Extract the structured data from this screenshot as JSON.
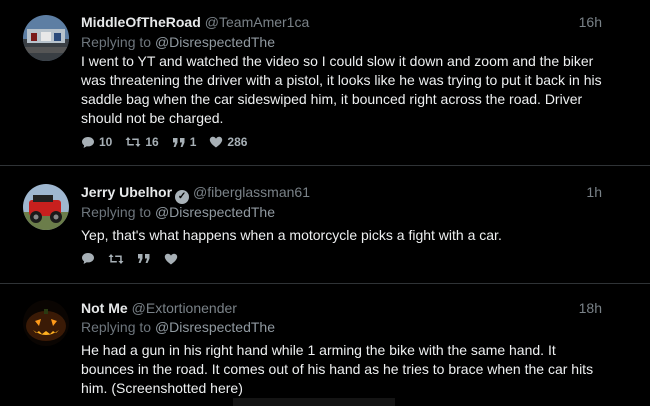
{
  "tweets": [
    {
      "name": "MiddleOfTheRoad",
      "handle": "@TeamAmer1ca",
      "time": "16h",
      "reply_prefix": "Replying to ",
      "reply_to": "@DisrespectedThe",
      "text": "I went to YT and watched the video so I could slow it down and zoom and the biker was threatening the driver with a pistol, it looks like he was trying to put it back in his saddle bag when the car sideswiped him, it bounced right across the road. Driver should not be charged.",
      "counts": {
        "replies": "10",
        "retweets": "16",
        "quotes": "1",
        "likes": "286"
      }
    },
    {
      "name": "Jerry Ubelhor",
      "handle": "@fiberglassman61",
      "time": "1h",
      "reply_prefix": "Replying to ",
      "reply_to": "@DisrespectedThe",
      "text": "Yep, that's what happens when a motorcycle picks a fight with a car.",
      "counts": {
        "replies": "",
        "retweets": "",
        "quotes": "",
        "likes": ""
      }
    },
    {
      "name": "Not Me",
      "handle": "@Extortionender",
      "time": "18h",
      "reply_prefix": "Replying to ",
      "reply_to": "@DisrespectedThe",
      "text": "He had a gun in his right hand while 1 arming the bike with the same hand.  It bounces in the road. It comes out of his hand as he tries to brace when the car hits him. (Screenshotted here)"
    }
  ],
  "icons": {
    "reply": "speech-bubble-icon",
    "retweet": "retweet-arrows-icon",
    "quote": "quote-marks-icon",
    "like": "heart-icon",
    "verified": "verified-check-icon"
  },
  "colors": {
    "background": "#000000",
    "text": "#eef0f1",
    "muted": "#7a8288",
    "action": "#a7b0b6"
  }
}
